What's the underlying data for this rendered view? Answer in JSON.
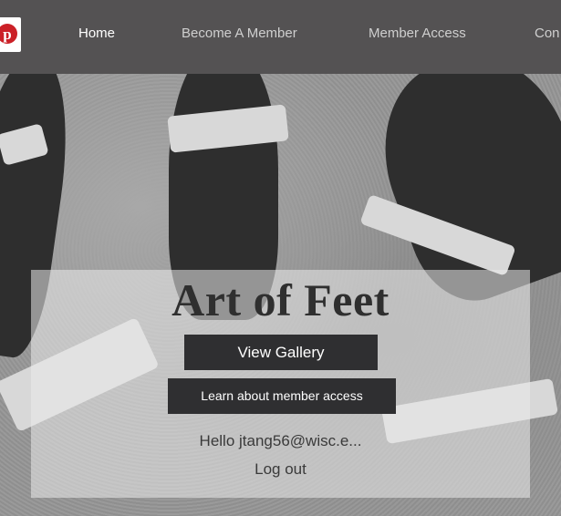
{
  "nav": {
    "items": [
      {
        "label": "Home",
        "active": true
      },
      {
        "label": "Become A Member",
        "active": false
      },
      {
        "label": "Member Access",
        "active": false
      },
      {
        "label": "Con",
        "active": false
      }
    ],
    "social_icon": "pinterest-icon",
    "bar_color": "#545253"
  },
  "hero": {
    "title": "Art of Feet",
    "gallery_button": "View Gallery",
    "member_button": "Learn about member access",
    "greeting": "Hello jtang56@wisc.e...",
    "logout": "Log out",
    "button_color": "#2f2f31"
  }
}
